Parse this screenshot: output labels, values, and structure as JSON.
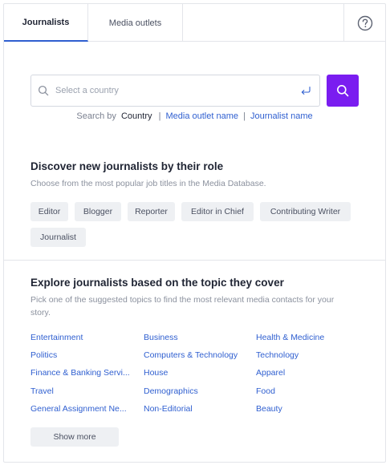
{
  "tabs": [
    {
      "label": "Journalists",
      "active": true
    },
    {
      "label": "Media outlets",
      "active": false
    }
  ],
  "help": {
    "icon": "question-circle-icon"
  },
  "search": {
    "placeholder": "Select a country",
    "value": "",
    "search_by_label": "Search by",
    "options": [
      "Country",
      "Media outlet name",
      "Journalist name"
    ],
    "active_option": "Country",
    "button_color": "#7a1df0"
  },
  "roles": {
    "title": "Discover new journalists by their role",
    "description": "Choose from the most popular job titles in the Media Database.",
    "chips": [
      "Editor",
      "Blogger",
      "Reporter",
      "Editor in Chief",
      "Contributing Writer",
      "Journalist"
    ]
  },
  "topics": {
    "title": "Explore journalists based on the topic they cover",
    "description": "Pick one of the suggested topics to find the most relevant media contacts for your story.",
    "items": [
      "Entertainment",
      "Business",
      "Health & Medicine",
      "Politics",
      "Computers & Technology",
      "Technology",
      "Finance & Banking Servi...",
      "House",
      "Apparel",
      "Travel",
      "Demographics",
      "Food",
      "General Assignment Ne...",
      "Non-Editorial",
      "Beauty"
    ],
    "show_more_label": "Show more",
    "link_color": "#2f5fd0"
  }
}
